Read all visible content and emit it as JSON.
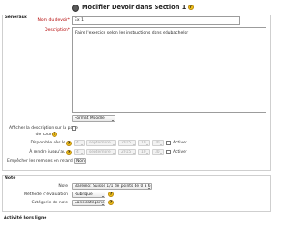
{
  "page": {
    "title": "Modifier Devoir dans Section 1"
  },
  "general": {
    "legend": "Généraux",
    "name_label": "Nom du devoir",
    "name_value": "Ex 1",
    "description_label": "Description",
    "description_parts": [
      "Faire",
      "l'exercice",
      "selon",
      "les",
      "instructions",
      "dans",
      "edubachelor"
    ],
    "format_select": "Format Moodle",
    "show_description_label_1": "Afficher la description sur la page",
    "show_description_label_2": "de cours",
    "available_from_label": "Disponible dès le",
    "due_date_label": "À rendre jusqu'au",
    "available_from": {
      "day": "4",
      "month": "septembre",
      "year": "2015",
      "hour": "10",
      "minute": "30"
    },
    "due_date": {
      "day": "4",
      "month": "septembre",
      "year": "2015",
      "hour": "10",
      "minute": "30"
    },
    "enable_label": "Activer",
    "prevent_late_label": "Empêcher les remises en retard",
    "prevent_late_value": "Non"
  },
  "grade": {
    "legend": "Note",
    "grade_label": "Note",
    "grade_value": "Baremo: Suisse 1/1 de points de 0 à 6",
    "method_label": "Méthode d'évaluation",
    "method_value": "Rubrique",
    "category_label": "Catégorie de note",
    "category_value": "Sans catégorie"
  },
  "next_section": {
    "label": "Activité hors ligne"
  },
  "icons": {
    "help": "?"
  }
}
